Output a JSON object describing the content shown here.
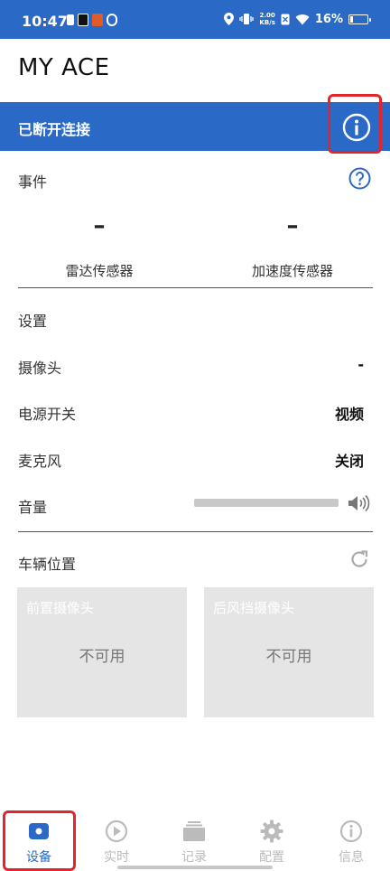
{
  "status_bar": {
    "time": "10:47",
    "net_speed_value": "2.00",
    "net_speed_unit": "KB/s",
    "battery_percent": "16%",
    "battery_level": 0.16,
    "left_icons": [
      "sim-icon",
      "tiktok-icon",
      "app-icon",
      "app-icon"
    ],
    "right_icons": [
      "location-icon",
      "vibrate-icon",
      "wifi-icon",
      "battery-icon"
    ]
  },
  "header": {
    "title": "MY ACE"
  },
  "connection": {
    "status_label": "已断开连接",
    "icon": "info-icon"
  },
  "events": {
    "label": "事件",
    "help_icon": "help-icon"
  },
  "sensors": [
    {
      "value": "–",
      "name": "雷达传感器"
    },
    {
      "value": "–",
      "name": "加速度传感器"
    }
  ],
  "settings": {
    "label": "设置",
    "rows": [
      {
        "key": "摄像头",
        "value": "-"
      },
      {
        "key": "电源开关",
        "value": "视频"
      },
      {
        "key": "麦克风",
        "value": "关闭"
      }
    ],
    "volume": {
      "label": "音量",
      "level": 1.0,
      "icon": "speaker-icon"
    }
  },
  "vehicle_position": {
    "label": "车辆位置",
    "refresh_icon": "refresh-icon",
    "cameras": [
      {
        "caption": "前置摄像头",
        "status": "不可用"
      },
      {
        "caption": "后风挡摄像头",
        "status": "不可用"
      }
    ]
  },
  "bottom_nav": {
    "items": [
      {
        "label": "设备",
        "icon": "device-icon",
        "active": true
      },
      {
        "label": "实时",
        "icon": "play-icon",
        "active": false
      },
      {
        "label": "记录",
        "icon": "records-icon",
        "active": false
      },
      {
        "label": "配置",
        "icon": "gear-icon",
        "active": false
      },
      {
        "label": "信息",
        "icon": "info-icon",
        "active": false
      }
    ]
  },
  "colors": {
    "primary": "#2b69c6",
    "annotation": "#e0262c",
    "card_bg": "#e5e5e5",
    "inactive": "#bbbbbb"
  }
}
